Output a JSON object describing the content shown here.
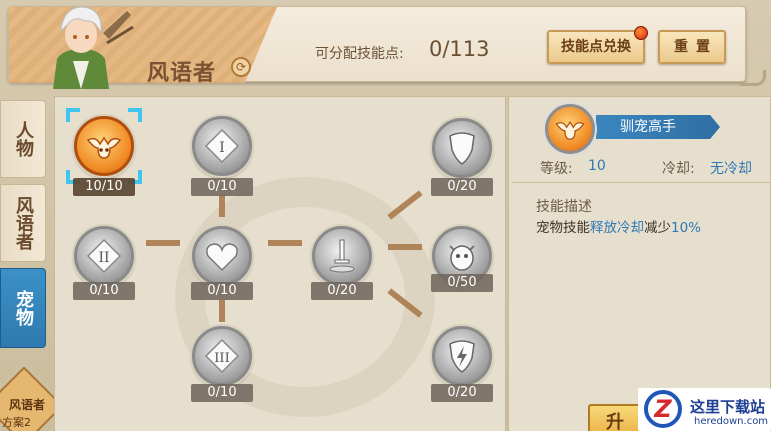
{
  "header": {
    "class_name": "风语者",
    "points_label": "可分配技能点:",
    "points_value": "0/113",
    "exchange_button": "技能点兑换",
    "reset_button": "重置"
  },
  "tabs": [
    {
      "label": "人物",
      "active": false
    },
    {
      "label": "风语者",
      "active": false
    },
    {
      "label": "宠物",
      "active": true
    }
  ],
  "plan_badge": {
    "title": "风语者",
    "subtitle": "方案2"
  },
  "nodes": {
    "pet_master": {
      "level": "10/10",
      "icon": "winged-pet-emblem-icon",
      "selected": true
    },
    "col1_tier1": {
      "level": "0/10",
      "icon": "tier-one-icon"
    },
    "col1_tier2": {
      "level": "0/10",
      "icon": "tier-two-icon"
    },
    "col2_heart": {
      "level": "0/10",
      "icon": "heart-icon"
    },
    "col2_tier3": {
      "level": "0/10",
      "icon": "tier-three-icon"
    },
    "col3_sword": {
      "level": "0/20",
      "icon": "sword-icon"
    },
    "col4_shield": {
      "level": "0/20",
      "icon": "shield-icon"
    },
    "col4_pet": {
      "level": "0/50",
      "icon": "pet-creature-icon"
    },
    "col4_bolt_shield": {
      "level": "0/20",
      "icon": "lightning-shield-icon"
    }
  },
  "detail": {
    "skill_name": "驯宠高手",
    "level_label": "等级:",
    "level_value": "10",
    "cooldown_label": "冷却:",
    "cooldown_value": "无冷却",
    "desc_title": "技能描述",
    "desc_part1": "宠物技能",
    "desc_highlight": "释放冷却",
    "desc_part2": "减少",
    "desc_value": "10%",
    "upgrade_button": "升"
  },
  "watermark": {
    "logo_text": "这里下载站",
    "logo_url_text": "heredown.com"
  }
}
